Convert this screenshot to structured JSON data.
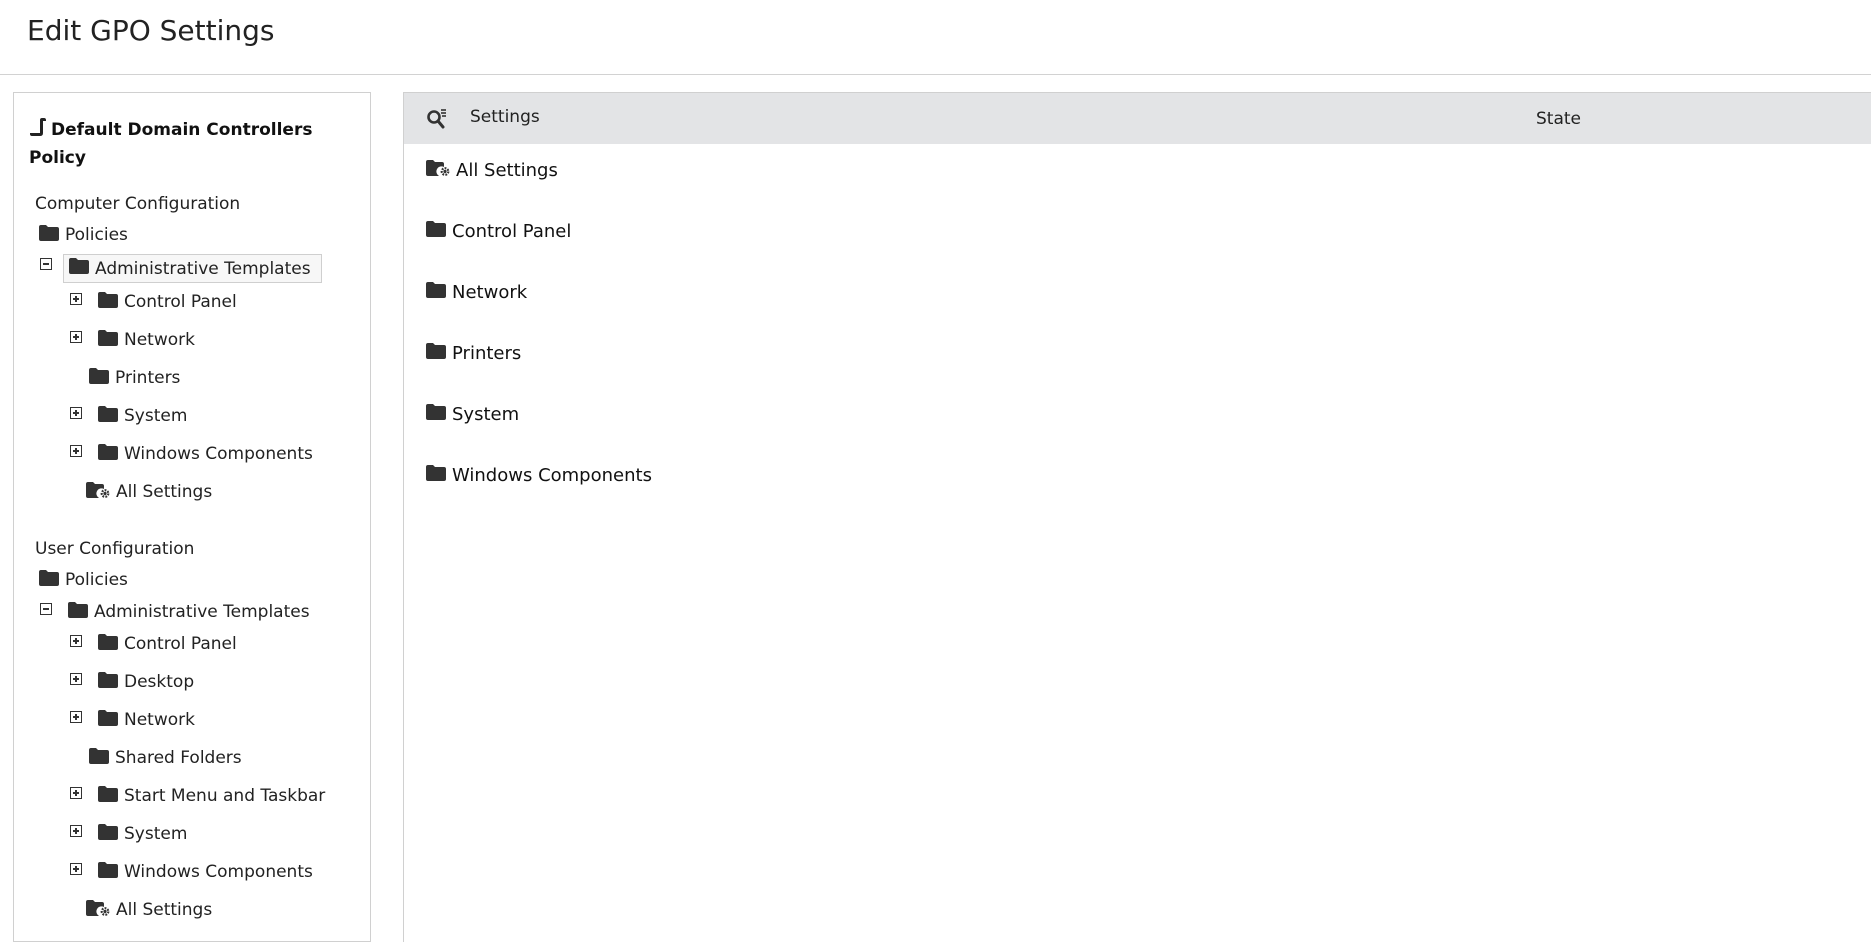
{
  "page": {
    "title": "Edit GPO Settings"
  },
  "tree": {
    "policy_name": "Default Domain Controllers Policy",
    "computer": {
      "label": "Computer Configuration",
      "policies": "Policies",
      "admin_templates": "Administrative Templates",
      "items": [
        {
          "label": "Control Panel",
          "expander": "plus"
        },
        {
          "label": "Network",
          "expander": "plus"
        },
        {
          "label": "Printers",
          "expander": "none"
        },
        {
          "label": "System",
          "expander": "plus"
        },
        {
          "label": "Windows Components",
          "expander": "plus"
        },
        {
          "label": "All Settings",
          "expander": "none",
          "icon": "folder-gear-icon"
        }
      ]
    },
    "user": {
      "label": "User Configuration",
      "policies": "Policies",
      "admin_templates": "Administrative Templates",
      "items": [
        {
          "label": "Control Panel",
          "expander": "plus"
        },
        {
          "label": "Desktop",
          "expander": "plus"
        },
        {
          "label": "Network",
          "expander": "plus"
        },
        {
          "label": "Shared Folders",
          "expander": "none"
        },
        {
          "label": "Start Menu and Taskbar",
          "expander": "plus"
        },
        {
          "label": "System",
          "expander": "plus"
        },
        {
          "label": "Windows Components",
          "expander": "plus"
        },
        {
          "label": "All Settings",
          "expander": "none",
          "icon": "folder-gear-icon"
        }
      ]
    }
  },
  "grid": {
    "col_settings": "Settings",
    "col_state": "State",
    "items": [
      {
        "label": "All Settings",
        "icon": "folder-gear-icon"
      },
      {
        "label": "Control Panel",
        "icon": "folder-icon"
      },
      {
        "label": "Network",
        "icon": "folder-icon"
      },
      {
        "label": "Printers",
        "icon": "folder-icon"
      },
      {
        "label": "System",
        "icon": "folder-icon"
      },
      {
        "label": "Windows Components",
        "icon": "folder-icon"
      }
    ]
  },
  "colors": {
    "header_bg": "#e3e4e6",
    "icon": "#333333"
  }
}
